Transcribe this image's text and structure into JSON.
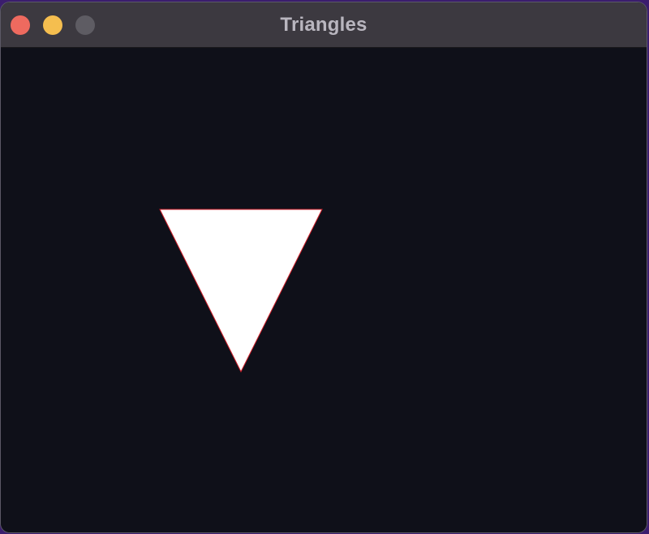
{
  "window": {
    "title": "Triangles"
  },
  "traffic_lights": {
    "close_color": "#ee6a5f",
    "minimize_color": "#f5be4f",
    "zoom_color": "#5e5c63"
  },
  "canvas": {
    "background": "#0f1019",
    "shape": {
      "kind": "triangle",
      "orientation": "pointing-down",
      "fill": "#ffffff",
      "stroke": "#d11f2a"
    }
  }
}
